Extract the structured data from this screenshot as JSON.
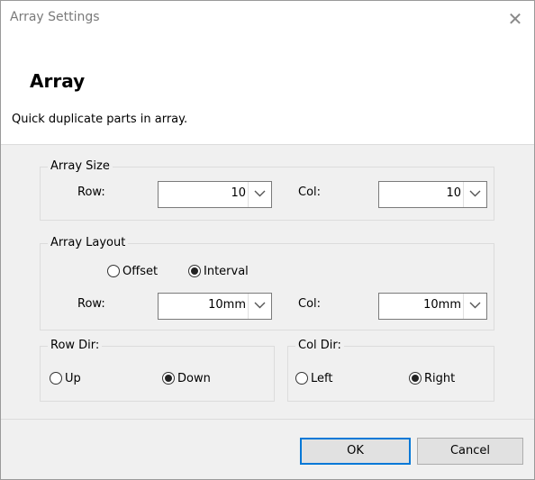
{
  "window": {
    "title": "Array Settings",
    "close_glyph": "✕"
  },
  "header": {
    "heading": "Array",
    "description": "Quick duplicate parts in array."
  },
  "array_size": {
    "label": "Array Size",
    "row_label": "Row:",
    "row_value": "10",
    "col_label": "Col:",
    "col_value": "10"
  },
  "array_layout": {
    "label": "Array Layout",
    "offset_label": "Offset",
    "interval_label": "Interval",
    "selected": "Interval",
    "row_label": "Row:",
    "row_value": "10mm",
    "col_label": "Col:",
    "col_value": "10mm"
  },
  "row_dir": {
    "label": "Row Dir:",
    "up_label": "Up",
    "down_label": "Down",
    "selected": "Down"
  },
  "col_dir": {
    "label": "Col Dir:",
    "left_label": "Left",
    "right_label": "Right",
    "selected": "Right"
  },
  "buttons": {
    "ok": "OK",
    "cancel": "Cancel"
  },
  "colors": {
    "accent": "#0078d7",
    "panel": "#f0f0f0",
    "border": "#dcdcdc"
  },
  "icons": {
    "close": "close-icon",
    "dropdown": "chevron-down-icon"
  }
}
